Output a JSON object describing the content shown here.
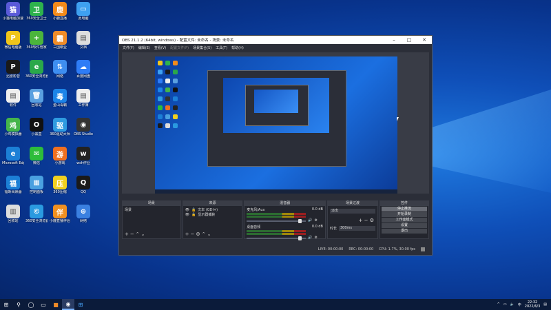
{
  "desktop_icons": [
    {
      "label": "小猫电脑加速",
      "color": "#5a5ad8",
      "glyph": "猫"
    },
    {
      "label": "360安全卫士",
      "color": "#2eb24d",
      "glyph": "卫"
    },
    {
      "label": "小鹿直播",
      "color": "#f28a1a",
      "glyph": "鹿"
    },
    {
      "label": "此电脑",
      "color": "#3ea0f0",
      "glyph": "▭"
    },
    {
      "label": "微信电脑版",
      "color": "#f0c51a",
      "glyph": "P"
    },
    {
      "label": "360软件管家",
      "color": "#4bb43c",
      "glyph": "+"
    },
    {
      "label": "三国霸业",
      "color": "#f08c28",
      "glyph": "霸"
    },
    {
      "label": "文档",
      "color": "#ddd",
      "glyph": "▤"
    },
    {
      "label": "迅雷影音",
      "color": "#1a1a1a",
      "glyph": "P"
    },
    {
      "label": "360安全浏览器",
      "color": "#2aa84a",
      "glyph": "e"
    },
    {
      "label": "网络",
      "color": "#3e8ef0",
      "glyph": "⇅"
    },
    {
      "label": "百度网盘",
      "color": "#2e7cf6",
      "glyph": "☁"
    },
    {
      "label": "软件",
      "color": "#eee",
      "glyph": "▤"
    },
    {
      "label": "回收站",
      "color": "#5aa0e0",
      "glyph": "🗑"
    },
    {
      "label": "金山毒霸",
      "color": "#1c84e8",
      "glyph": "毒"
    },
    {
      "label": "工作簿",
      "color": "#eee",
      "glyph": "▤"
    },
    {
      "label": "小鸡模拟器",
      "color": "#45b54a",
      "glyph": "鸡"
    },
    {
      "label": "小黑盒",
      "color": "#111",
      "glyph": "O"
    },
    {
      "label": "360驱动大师",
      "color": "#2f9be0",
      "glyph": "驱"
    },
    {
      "label": "OBS Studio",
      "color": "#333",
      "glyph": "◉"
    },
    {
      "label": "Microsoft Edge",
      "color": "#1c7fd6",
      "glyph": "e"
    },
    {
      "label": "微信",
      "color": "#2dbd3a",
      "glyph": "✉"
    },
    {
      "label": "小游戏",
      "color": "#f07020",
      "glyph": "游"
    },
    {
      "label": "wsh作业",
      "color": "#222",
      "glyph": "w"
    },
    {
      "label": "福昕阅读器",
      "color": "#1c7fd6",
      "glyph": "福"
    },
    {
      "label": "控制面板",
      "color": "#4aa0e0",
      "glyph": "▦"
    },
    {
      "label": "360压缩",
      "color": "#f0d020",
      "glyph": "压"
    },
    {
      "label": "QQ",
      "color": "#1a1a1a",
      "glyph": "Q"
    },
    {
      "label": "回收站",
      "color": "#ddd",
      "glyph": "▥"
    },
    {
      "label": "360安全浏览器",
      "color": "#2a9ae0",
      "glyph": "©"
    },
    {
      "label": "小鹿直播伴侣",
      "color": "#f09020",
      "glyph": "伴"
    },
    {
      "label": "网络",
      "color": "#3a80e0",
      "glyph": "⊕"
    }
  ],
  "obs": {
    "title": "OBS 21.1.2 (64bit, windows) - 配置文件: 未命名 - 场景: 未命名",
    "menu": [
      "文件(F)",
      "编辑(E)",
      "查看(V)",
      "配置文件(P)",
      "场景集合(S)",
      "工具(T)",
      "帮助(H)"
    ],
    "docks": {
      "scenes": {
        "title": "场景",
        "items": [
          "场景"
        ]
      },
      "sources": {
        "title": "来源",
        "items": [
          "文本 (GDI+)",
          "显示器捕获"
        ]
      },
      "mixer": {
        "title": "混音器",
        "channels": [
          {
            "name": "麦克风/Aux",
            "level": "0.0 dB"
          },
          {
            "name": "桌面音频",
            "level": "0.0 dB"
          }
        ]
      },
      "transitions": {
        "title": "场景过渡",
        "type": "淡出",
        "duration_label": "时长",
        "duration": "300ms"
      },
      "controls": {
        "title": "控件",
        "buttons": [
          "停止推流",
          "开始录制",
          "工作室模式",
          "设置",
          "退出"
        ]
      }
    },
    "status": {
      "live": "LIVE: 00:00:00",
      "rec": "REC: 00:00:00",
      "cpu": "CPU: 1.7%, 30.00 fps"
    }
  },
  "taskbar": {
    "time": "22:32",
    "date": "2022/6/3",
    "lang": "中"
  }
}
